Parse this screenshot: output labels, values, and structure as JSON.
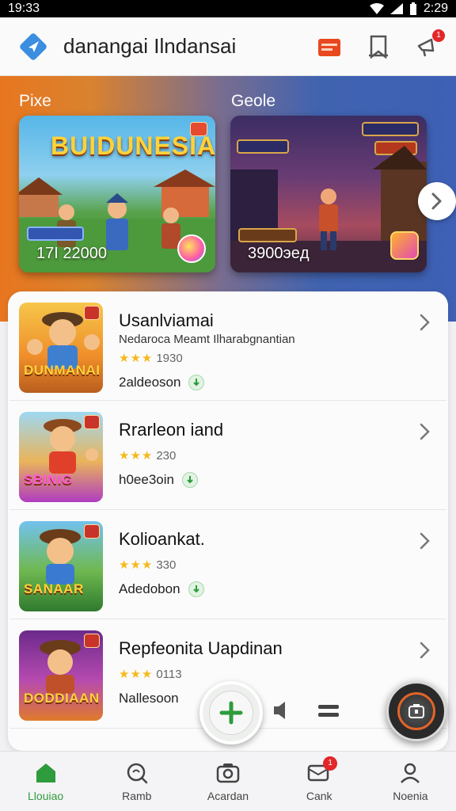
{
  "status_bar": {
    "time": "19:33",
    "clock_right": "2:29"
  },
  "app_bar": {
    "title": "danangai Ilndansai",
    "notification_count": "1"
  },
  "hero": {
    "left_label": "Pixe",
    "right_label": "Geole",
    "cards": [
      {
        "title": "BUIDUNESIAI",
        "score": "17I 22000"
      },
      {
        "title": "",
        "score": "3900эeд"
      }
    ]
  },
  "games": [
    {
      "title": "Usanlviamai",
      "subtitle": "Nedaroca Meamt Ilharabgnantian",
      "stars": "★★★",
      "rating": "1930",
      "size": "2aldeoson",
      "thumb_text": "DUNMANAI"
    },
    {
      "title": "Rrarleon iand",
      "subtitle": "",
      "stars": "★★★",
      "rating": "230",
      "size": "h0ee3oin",
      "thumb_text": "SBINIG"
    },
    {
      "title": "Kolioankat.",
      "subtitle": "",
      "stars": "★★★",
      "rating": "330",
      "size": "Adedobon",
      "thumb_text": "SANAAR"
    },
    {
      "title": "Repfeonita Uapdinan",
      "subtitle": "",
      "stars": "★★★",
      "rating": "0113",
      "size": "Nallesoon",
      "thumb_text": "DODDIAAN"
    }
  ],
  "bottom_nav": [
    {
      "label": "Llouiao",
      "icon": "home-icon",
      "active": true
    },
    {
      "label": "Ramb",
      "icon": "search-icon",
      "active": false
    },
    {
      "label": "Acardan",
      "icon": "camera-icon",
      "active": false
    },
    {
      "label": "Cank",
      "icon": "inbox-icon",
      "active": false,
      "badge": "1"
    },
    {
      "label": "Noenia",
      "icon": "profile-icon",
      "active": false
    }
  ],
  "colors": {
    "accent_orange": "#e8761f",
    "accent_blue": "#3e60b5",
    "active_green": "#2e9b3c",
    "badge_red": "#e3262a"
  }
}
